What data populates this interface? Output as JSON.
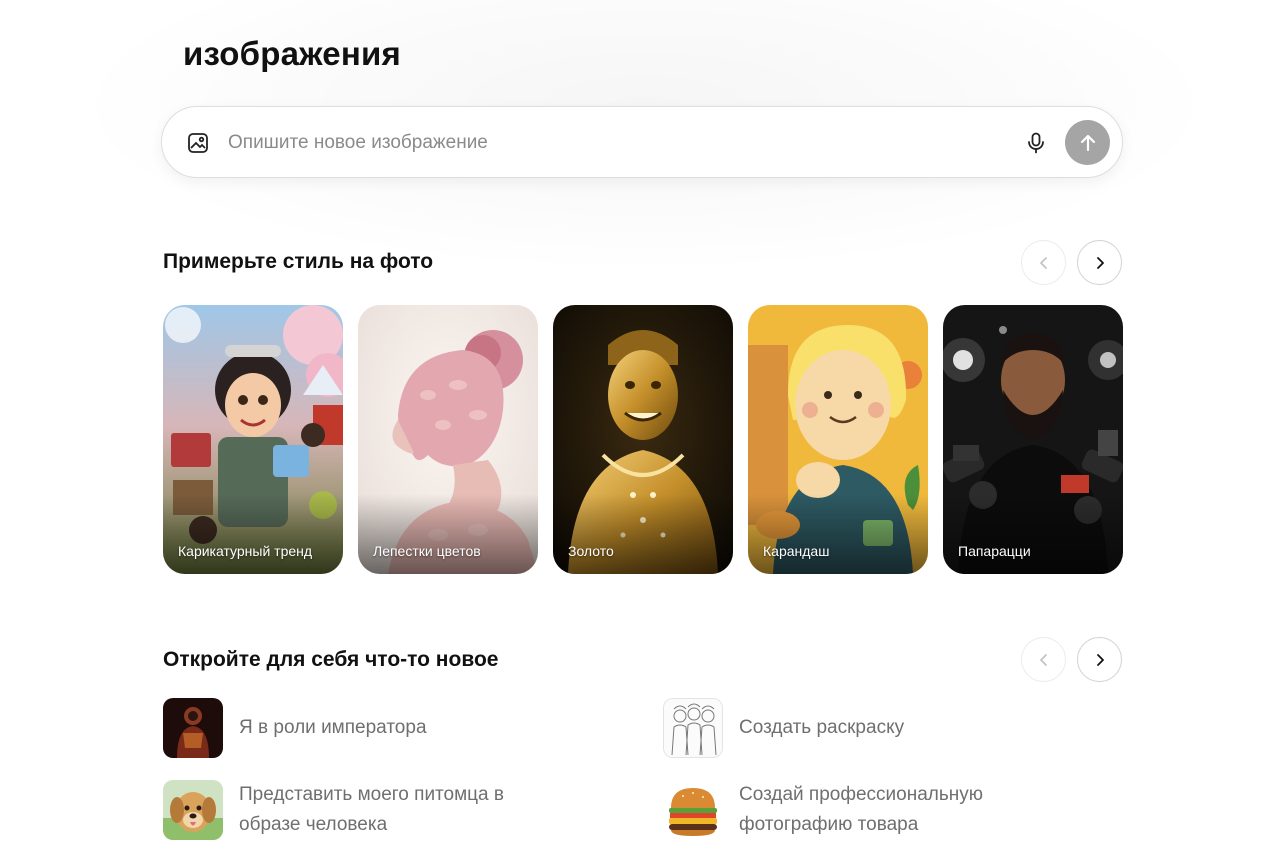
{
  "header": {
    "title": "изображения"
  },
  "prompt": {
    "placeholder": "Опишите новое изображение",
    "value": "",
    "image_icon": "image-icon",
    "mic_icon": "microphone-icon",
    "send_icon": "arrow-up-icon",
    "send_color": "#a5a5a5"
  },
  "styles_section": {
    "title": "Примерьте стиль на фото",
    "prev_icon": "chevron-left-icon",
    "next_icon": "chevron-right-icon",
    "cards": [
      {
        "label": "Карикатурный тренд",
        "image": "caricature-trend-image"
      },
      {
        "label": "Лепестки цветов",
        "image": "flower-petals-image"
      },
      {
        "label": "Золото",
        "image": "gold-image"
      },
      {
        "label": "Карандаш",
        "image": "pencil-image"
      },
      {
        "label": "Папарацци",
        "image": "paparazzi-image"
      }
    ]
  },
  "discover_section": {
    "title": "Откройте для себя что-то новое",
    "prev_icon": "chevron-left-icon",
    "next_icon": "chevron-right-icon",
    "items": [
      {
        "label": "Я в роли императора",
        "image": "emperor-thumbnail"
      },
      {
        "label": "Создать раскраску",
        "image": "coloring-page-thumbnail"
      },
      {
        "label": "Представить моего питомца в образе человека",
        "image": "dog-thumbnail"
      },
      {
        "label": "Создай профессиональную фотографию товара",
        "image": "burger-thumbnail"
      }
    ]
  }
}
